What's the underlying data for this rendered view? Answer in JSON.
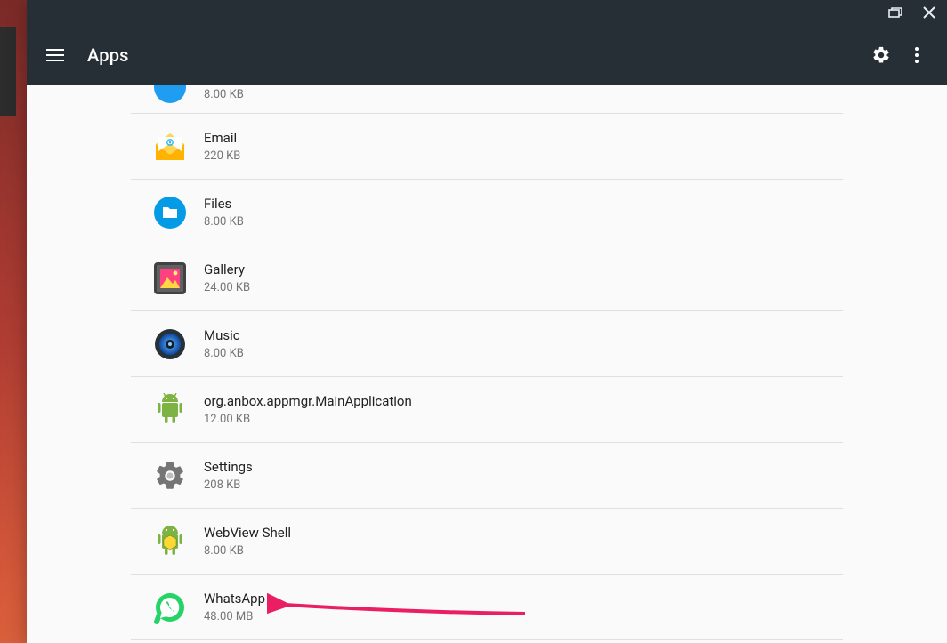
{
  "window": {
    "title": "Apps"
  },
  "apps": [
    {
      "name": "",
      "size": "8.00 KB",
      "icon": "partial-blue"
    },
    {
      "name": "Email",
      "size": "220 KB",
      "icon": "email"
    },
    {
      "name": "Files",
      "size": "8.00 KB",
      "icon": "files"
    },
    {
      "name": "Gallery",
      "size": "24.00 KB",
      "icon": "gallery"
    },
    {
      "name": "Music",
      "size": "8.00 KB",
      "icon": "music"
    },
    {
      "name": "org.anbox.appmgr.MainApplication",
      "size": "12.00 KB",
      "icon": "android"
    },
    {
      "name": "Settings",
      "size": "208 KB",
      "icon": "settings"
    },
    {
      "name": "WebView Shell",
      "size": "8.00 KB",
      "icon": "webview"
    },
    {
      "name": "WhatsApp",
      "size": "48.00 MB",
      "icon": "whatsapp"
    }
  ],
  "annotation": {
    "target": "WhatsApp",
    "color": "#e91e63"
  }
}
